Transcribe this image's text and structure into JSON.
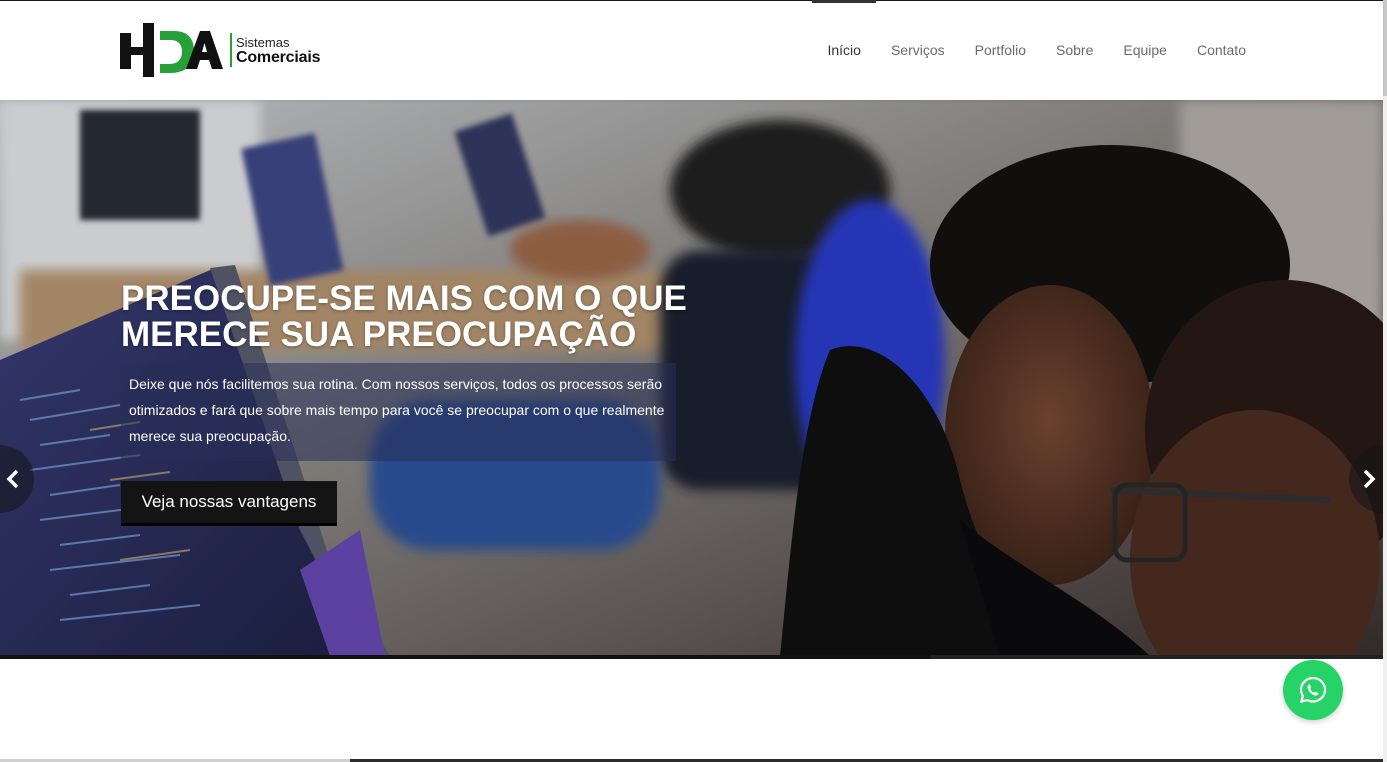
{
  "logo": {
    "mark_letters": "HDA",
    "line1": "Sistemas",
    "line2": "Comerciais",
    "brand_green": "#27a03a"
  },
  "nav": {
    "items": [
      "Início",
      "Serviços",
      "Portfolio",
      "Sobre",
      "Equipe",
      "Contato"
    ],
    "active": "Início"
  },
  "hero": {
    "title_line1": "PREOCUPE-SE MAIS COM O QUE",
    "title_line2": "MERECE SUA PREOCUPAÇÃO",
    "description": "Deixe que nós facilitemos sua rotina. Com nossos serviços, todos os processos serão otimizados e fará que sobre mais tempo para você se preocupar com o que realmente merece sua preocupação.",
    "cta_label": "Veja nossas vantagens",
    "prev_icon": "chevron-left-icon",
    "next_icon": "chevron-right-icon"
  },
  "whatsapp": {
    "icon": "whatsapp-icon",
    "color": "#25d366"
  }
}
